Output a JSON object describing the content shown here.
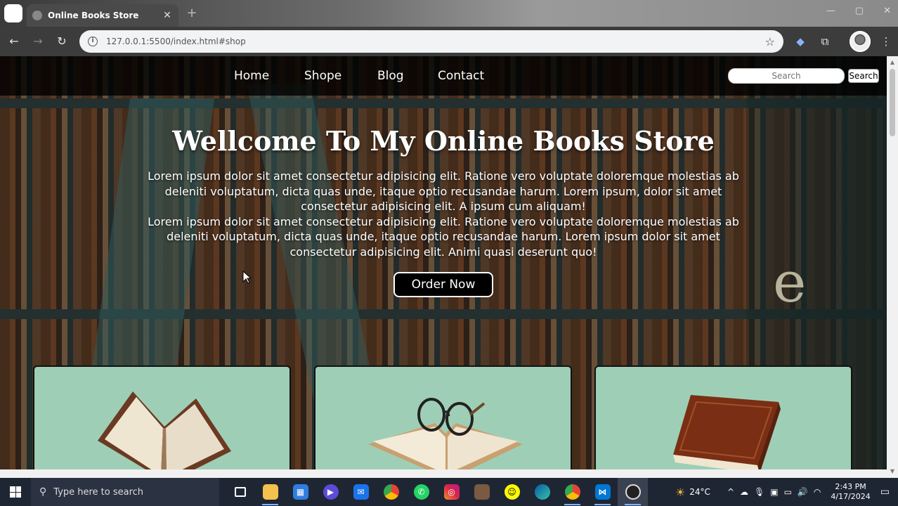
{
  "browser": {
    "tab_title": "Online Books Store",
    "tab_close": "✕",
    "new_tab": "+",
    "url": "127.0.0.1:5500/index.html#shop"
  },
  "nav": {
    "links": [
      "Home",
      "Shope",
      "Blog",
      "Contact"
    ],
    "search_placeholder": "Search",
    "search_button": "Search"
  },
  "hero": {
    "title": "Wellcome To My Online Books Store",
    "paragraph_1": "Lorem ipsum dolor sit amet consectetur adipisicing elit. Ratione vero voluptate doloremque molestias ab deleniti voluptatum, dicta quas unde, itaque optio recusandae harum. Lorem ipsum, dolor sit amet consectetur adipisicing elit. A ipsum cum aliquam!",
    "paragraph_2": "Lorem ipsum dolor sit amet consectetur adipisicing elit. Ratione vero voluptate doloremque molestias ab deleniti voluptatum, dicta quas unde, itaque optio recusandae harum. Lorem ipsum dolor sit amet consectetur adipisicing elit. Animi quasi deserunt quo!",
    "button": "Order Now",
    "decor_letter": "e"
  },
  "colors": {
    "card_bg": "#9ecfb6",
    "nav_bg": "#000000",
    "taskbar_bg": "#1f2633"
  },
  "taskbar": {
    "search_placeholder": "Type here to search",
    "weather": "24°C",
    "time": "2:43 PM",
    "date": "4/17/2024"
  }
}
